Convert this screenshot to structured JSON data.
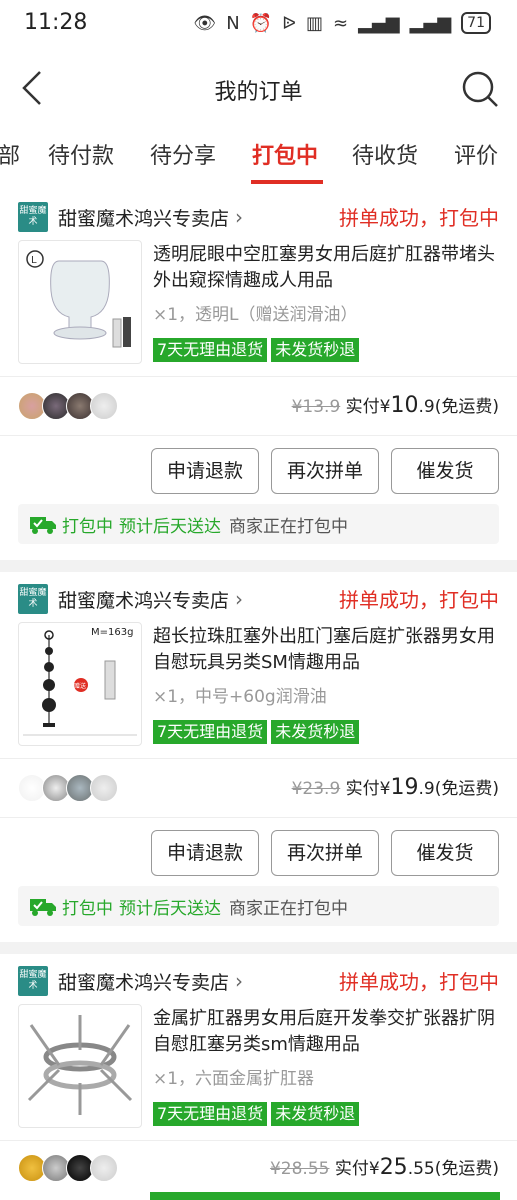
{
  "status_bar": {
    "time": "11:28",
    "battery": "71"
  },
  "nav": {
    "title": "我的订单"
  },
  "tabs": [
    "部",
    "待付款",
    "待分享",
    "打包中",
    "待收货",
    "评价"
  ],
  "orders": [
    {
      "shop_logo_text": "甜蜜魔术",
      "shop_name": "甜蜜魔术鸿兴专卖店",
      "status": "拼单成功，打包中",
      "title": "透明屁眼中空肛塞男女用后庭扩肛器带堵头外出窥探情趣成人用品",
      "spec": "×1，透明L（赠送润滑油）",
      "tags": [
        "7天无理由退货",
        "未发货秒退"
      ],
      "original_price": "¥13.9",
      "paid_label": "实付",
      "paid_symbol": "¥",
      "paid_int": "10",
      "paid_dec": ".9",
      "shipping": "(免运费)",
      "buttons": [
        "申请退款",
        "再次拼单",
        "催发货"
      ],
      "ship_status": "打包中",
      "ship_eta": "预计后天送达",
      "ship_note": "商家正在打包中"
    },
    {
      "shop_logo_text": "甜蜜魔术",
      "shop_name": "甜蜜魔术鸿兴专卖店",
      "status": "拼单成功，打包中",
      "title": "超长拉珠肛塞外出肛门塞后庭扩张器男女用自慰玩具另类SM情趣用品",
      "spec": "×1，中号+60g润滑油",
      "tags": [
        "7天无理由退货",
        "未发货秒退"
      ],
      "original_price": "¥23.9",
      "paid_label": "实付",
      "paid_symbol": "¥",
      "paid_int": "19",
      "paid_dec": ".9",
      "shipping": "(免运费)",
      "buttons": [
        "申请退款",
        "再次拼单",
        "催发货"
      ],
      "ship_status": "打包中",
      "ship_eta": "预计后天送达",
      "ship_note": "商家正在打包中",
      "image_text": "M=163g",
      "image_badge": "赠送"
    },
    {
      "shop_logo_text": "甜蜜魔术",
      "shop_name": "甜蜜魔术鸿兴专卖店",
      "status": "拼单成功，打包中",
      "title": "金属扩肛器男女用后庭开发拳交扩张器扩阴自慰肛塞另类sm情趣用品",
      "spec": "×1，六面金属扩肛器",
      "tags": [
        "7天无理由退货",
        "未发货秒退"
      ],
      "original_price": "¥28.55",
      "paid_label": "实付",
      "paid_symbol": "¥",
      "paid_int": "25",
      "paid_dec": ".55",
      "shipping": "(免运费)"
    }
  ],
  "colors": {
    "accent": "#e02e24",
    "green": "#27a82b",
    "logo": "#2a8c86"
  }
}
